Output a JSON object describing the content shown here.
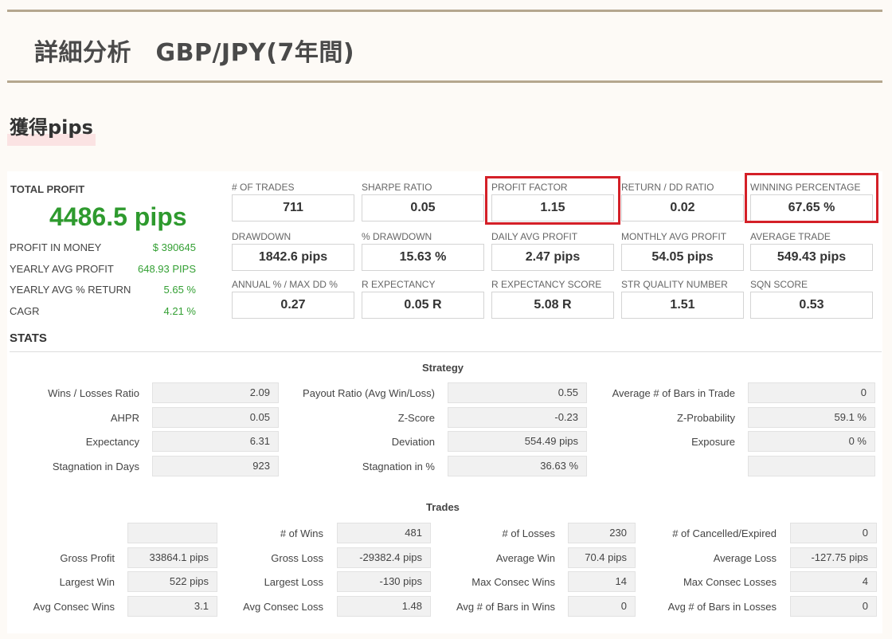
{
  "page": {
    "title": "詳細分析　GBP/JPY(7年間)",
    "section_heading": "獲得pips"
  },
  "total": {
    "label": "TOTAL PROFIT",
    "value": "4486.5 pips",
    "rows": [
      {
        "label": "PROFIT IN MONEY",
        "value": "$ 390645"
      },
      {
        "label": "YEARLY AVG PROFIT",
        "value": "648.93 PIPS"
      },
      {
        "label": "YEARLY AVG % RETURN",
        "value": "5.65 %"
      },
      {
        "label": "CAGR",
        "value": "4.21 %"
      }
    ]
  },
  "metrics": [
    {
      "label": "# OF TRADES",
      "value": "711",
      "highlighted": false
    },
    {
      "label": "SHARPE RATIO",
      "value": "0.05",
      "highlighted": false
    },
    {
      "label": "PROFIT FACTOR",
      "value": "1.15",
      "highlighted": true
    },
    {
      "label": "RETURN / DD RATIO",
      "value": "0.02",
      "highlighted": false
    },
    {
      "label": "WINNING PERCENTAGE",
      "value": "67.65 %",
      "highlighted": true
    },
    {
      "label": "DRAWDOWN",
      "value": "1842.6 pips",
      "highlighted": false
    },
    {
      "label": "% DRAWDOWN",
      "value": "15.63 %",
      "highlighted": false
    },
    {
      "label": "DAILY AVG PROFIT",
      "value": "2.47 pips",
      "highlighted": false
    },
    {
      "label": "MONTHLY AVG PROFIT",
      "value": "54.05 pips",
      "highlighted": false
    },
    {
      "label": "AVERAGE TRADE",
      "value": "549.43 pips",
      "highlighted": false
    },
    {
      "label": "ANNUAL % / MAX DD %",
      "value": "0.27",
      "highlighted": false
    },
    {
      "label": "R EXPECTANCY",
      "value": "0.05 R",
      "highlighted": false
    },
    {
      "label": "R EXPECTANCY SCORE",
      "value": "5.08 R",
      "highlighted": false
    },
    {
      "label": "STR QUALITY NUMBER",
      "value": "1.51",
      "highlighted": false
    },
    {
      "label": "SQN SCORE",
      "value": "0.53",
      "highlighted": false
    }
  ],
  "stats": {
    "label": "STATS",
    "strategy": {
      "title": "Strategy",
      "rows": [
        [
          {
            "label": "Wins / Losses Ratio",
            "value": "2.09"
          },
          {
            "label": "Payout Ratio (Avg Win/Loss)",
            "value": "0.55"
          },
          {
            "label": "Average # of Bars in Trade",
            "value": "0"
          }
        ],
        [
          {
            "label": "AHPR",
            "value": "0.05"
          },
          {
            "label": "Z-Score",
            "value": "-0.23"
          },
          {
            "label": "Z-Probability",
            "value": "59.1 %"
          }
        ],
        [
          {
            "label": "Expectancy",
            "value": "6.31"
          },
          {
            "label": "Deviation",
            "value": "554.49 pips"
          },
          {
            "label": "Exposure",
            "value": "0 %"
          }
        ],
        [
          {
            "label": "Stagnation in Days",
            "value": "923"
          },
          {
            "label": "Stagnation in %",
            "value": "36.63 %"
          },
          {
            "label": "",
            "value": ""
          }
        ]
      ]
    },
    "trades": {
      "title": "Trades",
      "rows": [
        [
          {
            "label": "",
            "value": ""
          },
          {
            "label": "# of Wins",
            "value": "481"
          },
          {
            "label": "# of Losses",
            "value": "230"
          },
          {
            "label": "# of Cancelled/Expired",
            "value": "0"
          }
        ],
        [
          {
            "label": "Gross Profit",
            "value": "33864.1 pips"
          },
          {
            "label": "Gross Loss",
            "value": "-29382.4 pips"
          },
          {
            "label": "Average Win",
            "value": "70.4 pips"
          },
          {
            "label": "Average Loss",
            "value": "-127.75 pips"
          }
        ],
        [
          {
            "label": "Largest Win",
            "value": "522 pips"
          },
          {
            "label": "Largest Loss",
            "value": "-130 pips"
          },
          {
            "label": "Max Consec Wins",
            "value": "14"
          },
          {
            "label": "Max Consec Losses",
            "value": "4"
          }
        ],
        [
          {
            "label": "Avg Consec Wins",
            "value": "3.1"
          },
          {
            "label": "Avg Consec Loss",
            "value": "1.48"
          },
          {
            "label": "Avg # of Bars in Wins",
            "value": "0"
          },
          {
            "label": "Avg # of Bars in Losses",
            "value": "0"
          }
        ]
      ]
    }
  }
}
